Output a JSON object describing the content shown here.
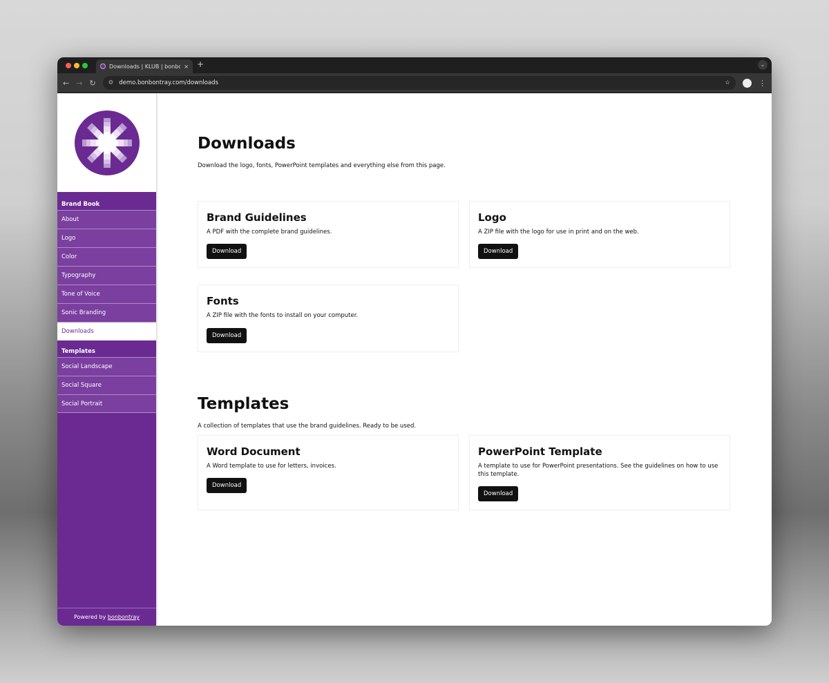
{
  "browser": {
    "tab_title": "Downloads | KLUB | bonbontray",
    "url": "demo.bonbontray.com/downloads",
    "new_tab": "+",
    "close": "×"
  },
  "colors": {
    "brand": "#6a2a92",
    "item": "#7a3f9f",
    "button": "#111111"
  },
  "sidebar": {
    "sections": [
      {
        "title": "Brand Book",
        "items": [
          "About",
          "Logo",
          "Color",
          "Typography",
          "Tone of Voice",
          "Sonic Branding",
          "Downloads"
        ]
      },
      {
        "title": "Templates",
        "items": [
          "Social Landscape",
          "Social Square",
          "Social Portrait"
        ]
      }
    ],
    "active": "Downloads",
    "footer_prefix": "Powered by ",
    "footer_link": "bonbontray"
  },
  "main": {
    "title": "Downloads",
    "description": "Download the logo, fonts, PowerPoint templates and everything else from this page.",
    "cards": [
      {
        "title": "Brand Guidelines",
        "text": "A PDF with the complete brand guidelines.",
        "button": "Download"
      },
      {
        "title": "Logo",
        "text": "A ZIP file with the logo for use in print and on the web.",
        "button": "Download"
      },
      {
        "title": "Fonts",
        "text": "A ZIP file with the fonts to install on your computer.",
        "button": "Download"
      }
    ],
    "templates": {
      "title": "Templates",
      "description": "A collection of templates that use the brand guidelines. Ready to be used.",
      "cards": [
        {
          "title": "Word Document",
          "text": "A Word template to use for letters, invoices.",
          "button": "Download"
        },
        {
          "title": "PowerPoint Template",
          "text": "A template to use for PowerPoint presentations. See the guidelines on how to use this template.",
          "button": "Download"
        }
      ]
    }
  }
}
